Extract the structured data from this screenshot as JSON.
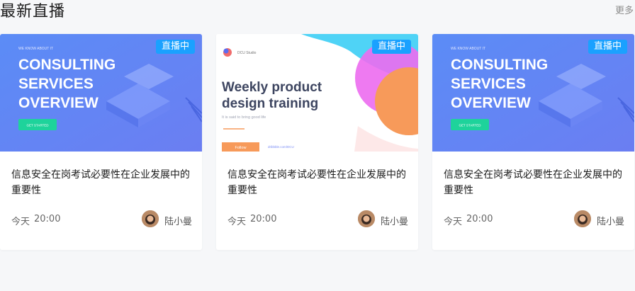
{
  "section": {
    "title": "最新直播",
    "more_label": "更多"
  },
  "cards": [
    {
      "badge": "直播中",
      "thumb": {
        "kicker": "WE KNOW ABOUT IT",
        "line1": "CONSULTING",
        "line2": "SERVICES",
        "line3": "OVERVIEW",
        "cta": "GET STARTED"
      },
      "title": "信息安全在岗考试必要性在企业发展中的重要性",
      "day": "今天",
      "time": "20:00",
      "author": "陆小曼"
    },
    {
      "badge": "直播中",
      "thumb": {
        "brand": "DCU Studio",
        "line1": "Weekly product",
        "line2": "design training",
        "tagline": "It is said to bring good life",
        "cta": "Follow",
        "link": "dribbble.com/DCU"
      },
      "title": "信息安全在岗考试必要性在企业发展中的重要性",
      "day": "今天",
      "time": "20:00",
      "author": "陆小曼"
    },
    {
      "badge": "直播中",
      "thumb": {
        "kicker": "WE KNOW ABOUT IT",
        "line1": "CONSULTING",
        "line2": "SERVICES",
        "line3": "OVERVIEW",
        "cta": "GET STARTED"
      },
      "title": "信息安全在岗考试必要性在企业发展中的重要性",
      "day": "今天",
      "time": "20:00",
      "author": "陆小曼"
    }
  ]
}
